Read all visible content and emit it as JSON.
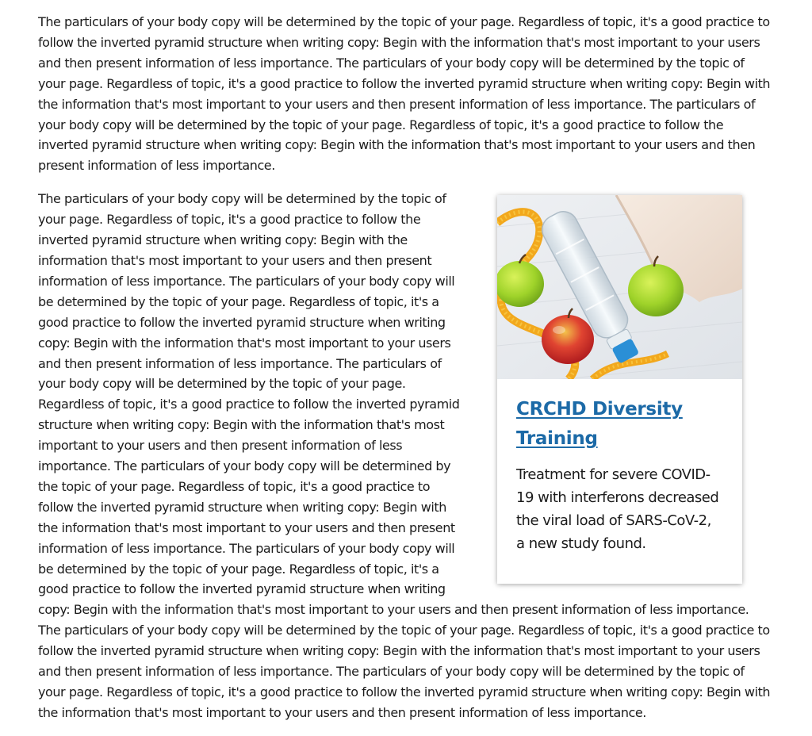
{
  "article": {
    "paragraph_1": "The particulars of your body copy will be determined by the topic of your page. Regardless of topic, it's a good practice to follow the inverted pyramid structure when writing copy: Begin with the information that's most important to your users and then present information of less importance. The particulars of your body copy will be determined by the topic of your page. Regardless of topic, it's a good practice to follow the inverted pyramid structure when writing copy: Begin with the information that's most important to your users and then present information of less importance. The particulars of your body copy will be determined by the topic of your page. Regardless of topic, it's a good practice to follow the inverted pyramid structure when writing copy: Begin with the information that's most important to your users and then present information of less importance.",
    "paragraph_2": "The particulars of your body copy will be determined by the topic of your page. Regardless of topic, it's a good practice to follow the inverted pyramid structure when writing copy: Begin with the information that's most important to your users and then present information of less importance. The particulars of your body copy will be determined by the topic of your page. Regardless of topic, it's a good practice to follow the inverted pyramid structure when writing copy: Begin with the information that's most important to your users and then present information of less importance. The particulars of your body copy will be determined by the topic of your page. Regardless of topic, it's a good practice to follow the inverted pyramid structure when writing copy: Begin with the information that's most important to your users and then present information of less importance. The particulars of your body copy will be determined by the topic of your page. Regardless of topic, it's a good practice to follow the inverted pyramid structure when writing copy: Begin with the information that's most important to your users and then present information of less importance. The particulars of your body copy will be determined by the topic of your page. Regardless of topic, it's a good practice to follow the inverted pyramid structure when writing copy: Begin with the information that's most important to your users and then present information of less importance. The particulars of your body copy will be determined by the topic of your page. Regardless of topic, it's a good practice to follow the inverted pyramid structure when writing copy: Begin with the information that's most important to your users and then present information of less importance. The particulars of your body copy will be determined by the topic of your page. Regardless of topic, it's a good practice to follow the inverted pyramid structure when writing copy: Begin with the information that's most important to your users and then present information of less importance."
  },
  "card": {
    "image_icon": "apples-water-bottle-measuring-tape-photo",
    "title": "CRCHD Diversity Training",
    "text": "Treatment for severe COVID-19 with interferons decreased the viral load of SARS-CoV-2, a new study found."
  },
  "colors": {
    "link": "#1c6aa7",
    "body_text": "#1b1b1b",
    "background": "#ffffff"
  }
}
